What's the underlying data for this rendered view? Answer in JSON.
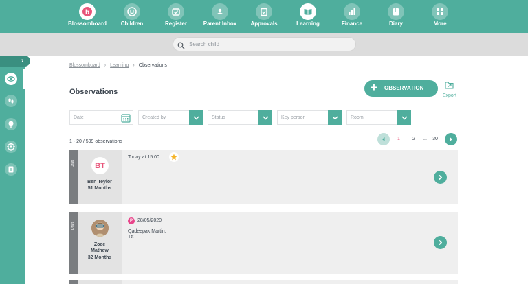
{
  "colors": {
    "brand": "#4fae9d",
    "accent_pink": "#e8557a",
    "draft": "#7a7d80"
  },
  "nav": {
    "items": [
      {
        "label": "Blossomboard",
        "icon": "blossom-logo-icon"
      },
      {
        "label": "Children",
        "icon": "smiley-icon"
      },
      {
        "label": "Register",
        "icon": "register-icon"
      },
      {
        "label": "Parent Inbox",
        "icon": "inbox-icon"
      },
      {
        "label": "Approvals",
        "icon": "clipboard-icon"
      },
      {
        "label": "Learning",
        "icon": "book-icon",
        "active": true
      },
      {
        "label": "Finance",
        "icon": "chart-icon"
      },
      {
        "label": "Diary",
        "icon": "diary-icon"
      },
      {
        "label": "More",
        "icon": "grid-icon"
      }
    ]
  },
  "search": {
    "placeholder": "Search child"
  },
  "sidebar": {
    "icons": [
      "eye-icon",
      "footprints-icon",
      "tree-icon",
      "target-icon",
      "report-icon"
    ],
    "active": "eye-icon"
  },
  "breadcrumb": {
    "items": [
      "Blossomboard",
      "Learning",
      "Observations"
    ],
    "separator": "›"
  },
  "page": {
    "title": "Observations"
  },
  "actions": {
    "add_label": "OBSERVATION",
    "export_label": "Export"
  },
  "filters": {
    "date": "Date",
    "created_by": "Created by",
    "status": "Status",
    "key_person": "Key person",
    "room": "Room"
  },
  "results": {
    "count": "1 - 20 / 599 observations"
  },
  "pagination": {
    "current": "1",
    "pages": [
      "1",
      "2",
      "...",
      "30"
    ]
  },
  "observations": [
    {
      "status": "Draft",
      "initials": "BT",
      "name_first": "Ben Teylor",
      "age": "51 Months",
      "time": "Today at 15:00",
      "starred": true
    },
    {
      "status": "Draft",
      "name_first": "Zoee",
      "name_last": "Mathew",
      "age": "32 Months",
      "badge": "P",
      "date": "28/05/2020",
      "author": "Qadeepak Martin:",
      "text": "Ttt"
    }
  ]
}
